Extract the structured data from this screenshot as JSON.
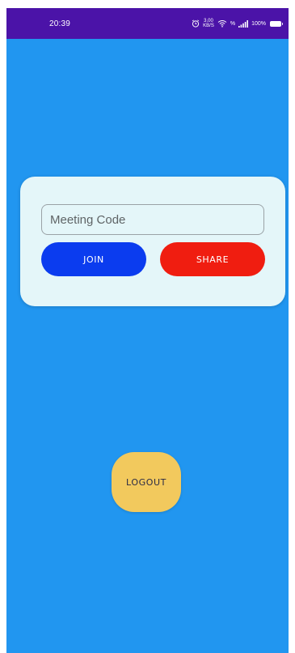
{
  "status_bar": {
    "time": "20:39",
    "net_speed_value": "3.00",
    "net_speed_unit": "KB/S",
    "sim_label": "%",
    "battery": "100%",
    "icons": [
      "alarm-icon",
      "wifi-icon",
      "signal-icon",
      "battery-icon"
    ]
  },
  "meeting": {
    "code_placeholder": "Meeting Code",
    "join_label": "JOIN",
    "share_label": "SHARE"
  },
  "logout_label": "LOGOUT",
  "colors": {
    "background": "#2196f0",
    "status_bar": "#4b13a8",
    "card": "#e4f6f9",
    "join": "#0b3cef",
    "share": "#f01d10",
    "logout": "#f2c95d"
  }
}
